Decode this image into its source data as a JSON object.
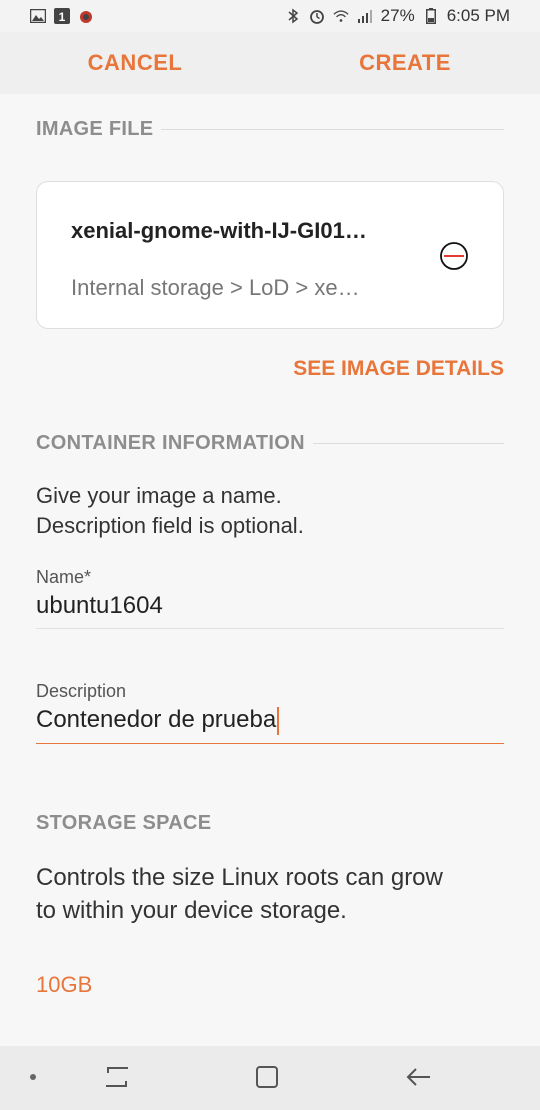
{
  "status_bar": {
    "battery_percent": "27%",
    "time": "6:05 PM",
    "left_icons": [
      "gallery-icon",
      "app-icon",
      "bug-icon"
    ],
    "right_icons": [
      "bluetooth-icon",
      "alarm-icon",
      "wifi-icon",
      "signal-icon",
      "battery-icon"
    ]
  },
  "action_bar": {
    "cancel_label": "CANCEL",
    "create_label": "CREATE"
  },
  "image_file": {
    "header": "IMAGE FILE",
    "file_name": "xenial-gnome-with-IJ-GI01…",
    "file_path": "Internal storage > LoD > xe…",
    "remove_icon": "remove-circle-icon",
    "see_details_label": "SEE IMAGE DETAILS"
  },
  "container_info": {
    "header": "CONTAINER INFORMATION",
    "description_line1": "Give your image a name.",
    "description_line2": "Description field is optional.",
    "name_label": "Name*",
    "name_value": "ubuntu1604",
    "description_label": "Description",
    "description_value": "Contenedor de prueba"
  },
  "storage": {
    "header": "STORAGE SPACE",
    "description_line1": "Controls the size Linux roots can grow",
    "description_line2": "to within your device storage.",
    "value": "10GB"
  },
  "colors": {
    "accent": "#e8763a",
    "header_gray": "#8d8d8d"
  }
}
